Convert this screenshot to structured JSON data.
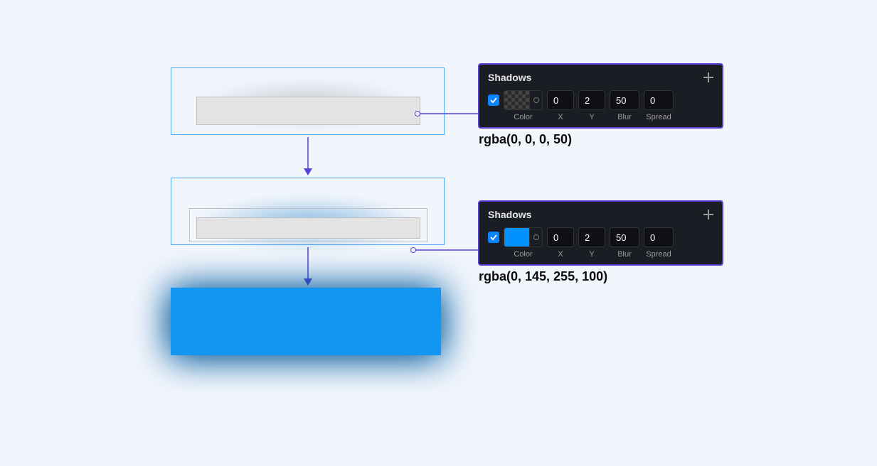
{
  "panel1": {
    "title": "Shadows",
    "checked": true,
    "colorSwatchType": "transparent",
    "x": "0",
    "y": "2",
    "blur": "50",
    "spread": "0",
    "labels": {
      "color": "Color",
      "x": "X",
      "y": "Y",
      "blur": "Blur",
      "spread": "Spread"
    },
    "caption": "rgba(0, 0, 0, 50)"
  },
  "panel2": {
    "title": "Shadows",
    "checked": true,
    "colorSwatchType": "blue",
    "x": "0",
    "y": "2",
    "blur": "50",
    "spread": "0",
    "labels": {
      "color": "Color",
      "x": "X",
      "y": "Y",
      "blur": "Blur",
      "spread": "Spread"
    },
    "caption": "rgba(0, 145, 255, 100)"
  }
}
